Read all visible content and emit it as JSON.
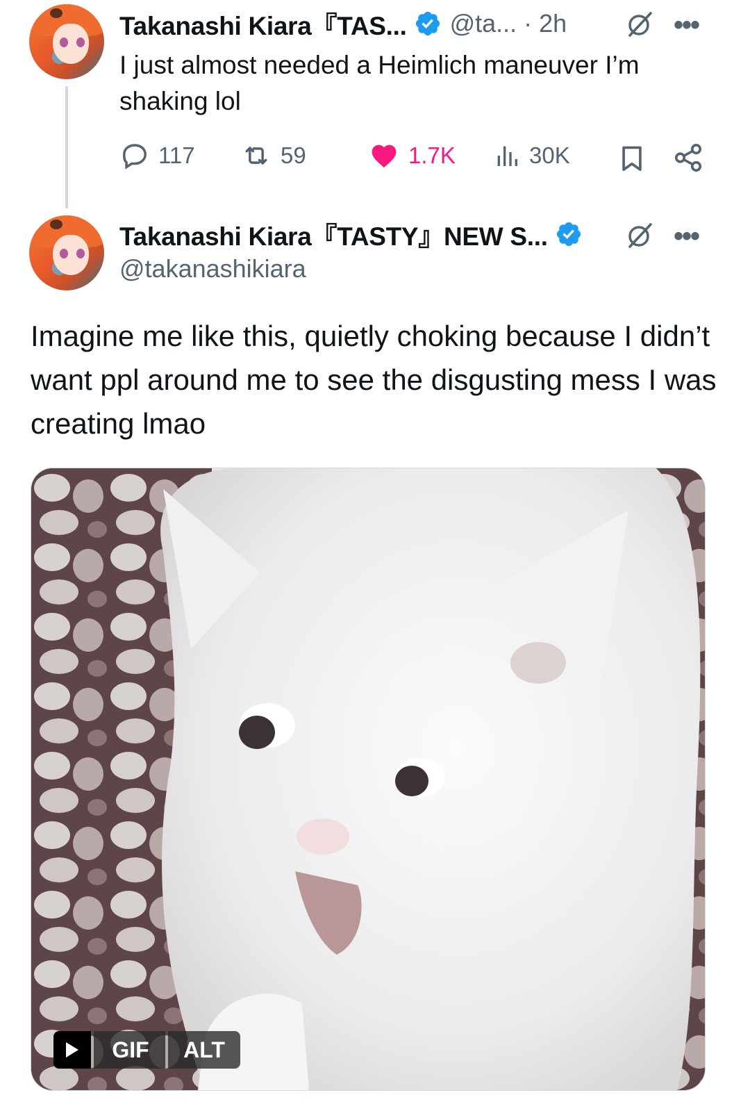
{
  "tweet1": {
    "author_name": "Takanashi Kiara『TAS...",
    "handle": "@ta...",
    "time": "· 2h",
    "text": "I just almost needed a Heimlich maneuver I’m shaking lol",
    "actions": {
      "replies": "117",
      "reposts": "59",
      "likes": "1.7K",
      "views": "30K"
    }
  },
  "tweet2": {
    "author_name": "Takanashi Kiara『TASTY』NEW S...",
    "handle": "@takanashikiara",
    "text": "Imagine me like this, quietly choking because I didn’t want ppl around me to see the disgusting mess I was creating lmao",
    "media": {
      "badge_gif": "GIF",
      "badge_alt": "ALT"
    }
  },
  "colors": {
    "text_primary": "#0f1419",
    "text_secondary": "#536471",
    "verified_blue": "#1d9bf0",
    "like_pink": "#f91880",
    "thread_line": "#cfd9de"
  },
  "icons": [
    "verified-badge-icon",
    "grok-icon",
    "more-icon",
    "reply-icon",
    "repost-icon",
    "like-icon",
    "views-icon",
    "bookmark-icon",
    "share-icon",
    "play-icon"
  ]
}
